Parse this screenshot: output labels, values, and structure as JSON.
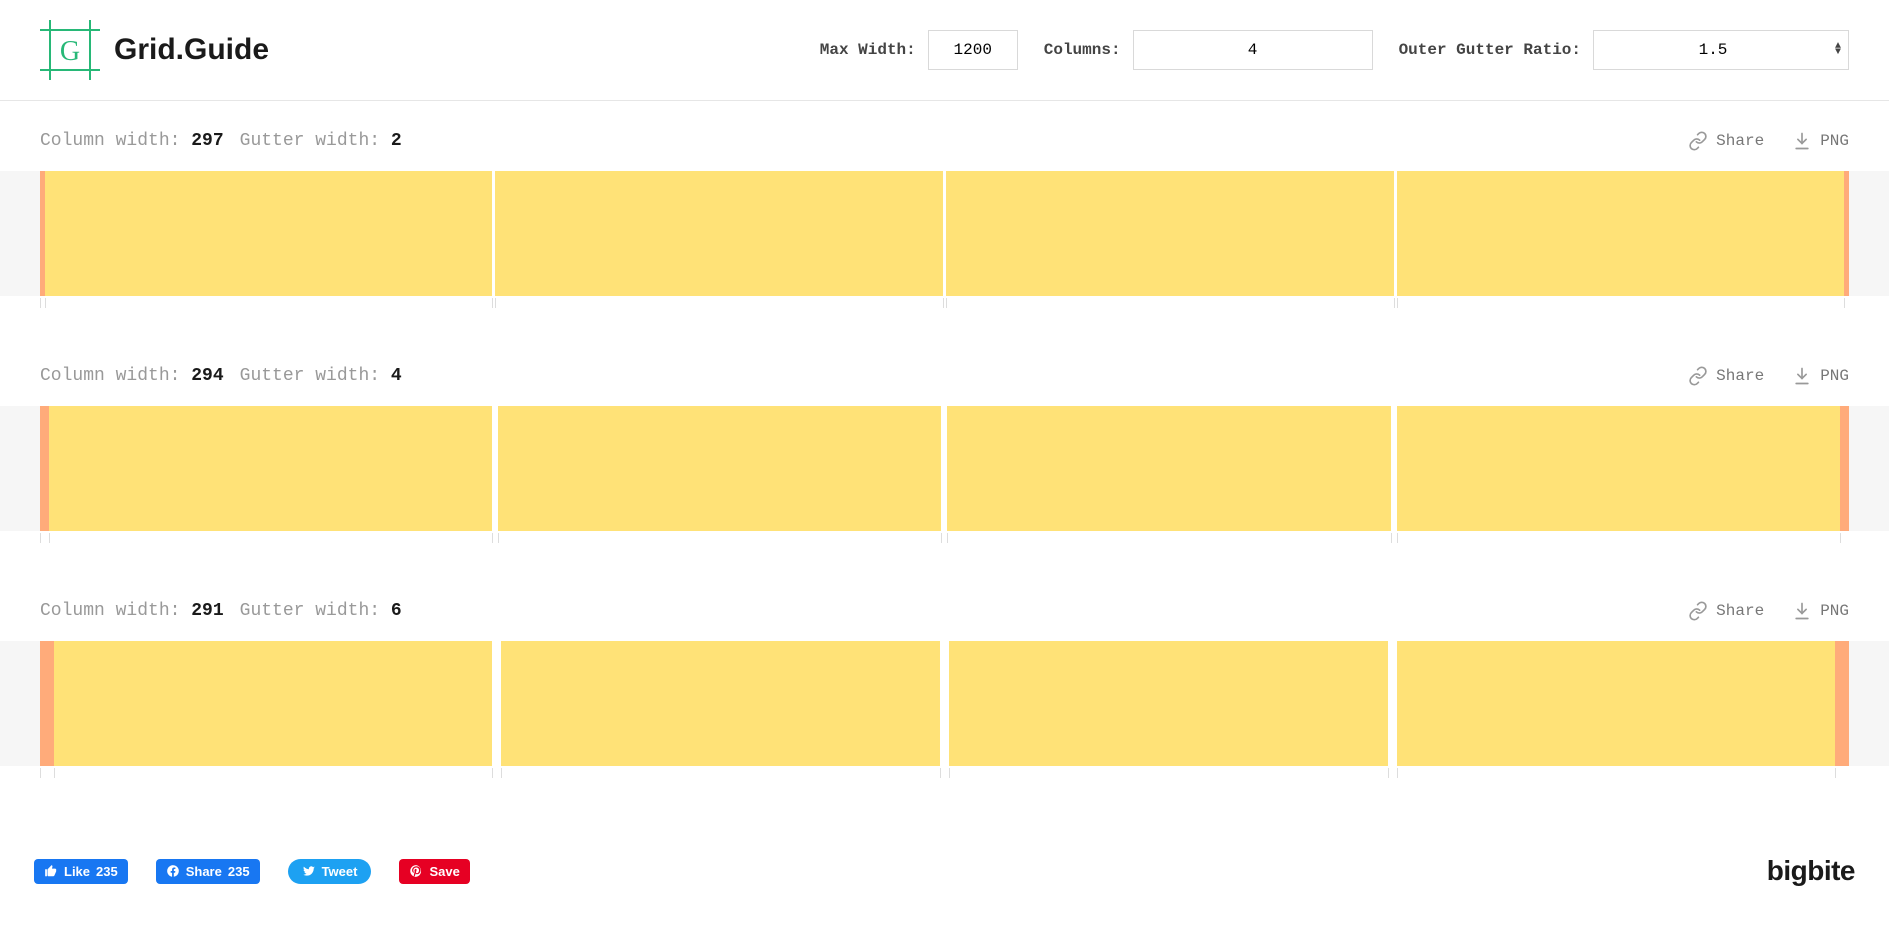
{
  "header": {
    "title": "Grid.Guide",
    "controls": {
      "max_width_label": "Max Width:",
      "max_width_value": "1200",
      "columns_label": "Columns:",
      "columns_value": "4",
      "outer_gutter_label": "Outer Gutter Ratio:",
      "outer_gutter_value": "1.5"
    }
  },
  "row_labels": {
    "column_width": "Column width:",
    "gutter_width": "Gutter width:",
    "share": "Share",
    "png": "PNG"
  },
  "rows": [
    {
      "column_width": "297",
      "gutter_width": "2"
    },
    {
      "column_width": "294",
      "gutter_width": "4"
    },
    {
      "column_width": "291",
      "gutter_width": "6"
    }
  ],
  "grid_config": {
    "columns": 4,
    "max_width": 1200
  },
  "footer": {
    "fb_like_label": "Like",
    "fb_like_count": "235",
    "fb_share_label": "Share",
    "fb_share_count": "235",
    "tweet_label": "Tweet",
    "pin_label": "Save",
    "brand": "bigbite"
  }
}
